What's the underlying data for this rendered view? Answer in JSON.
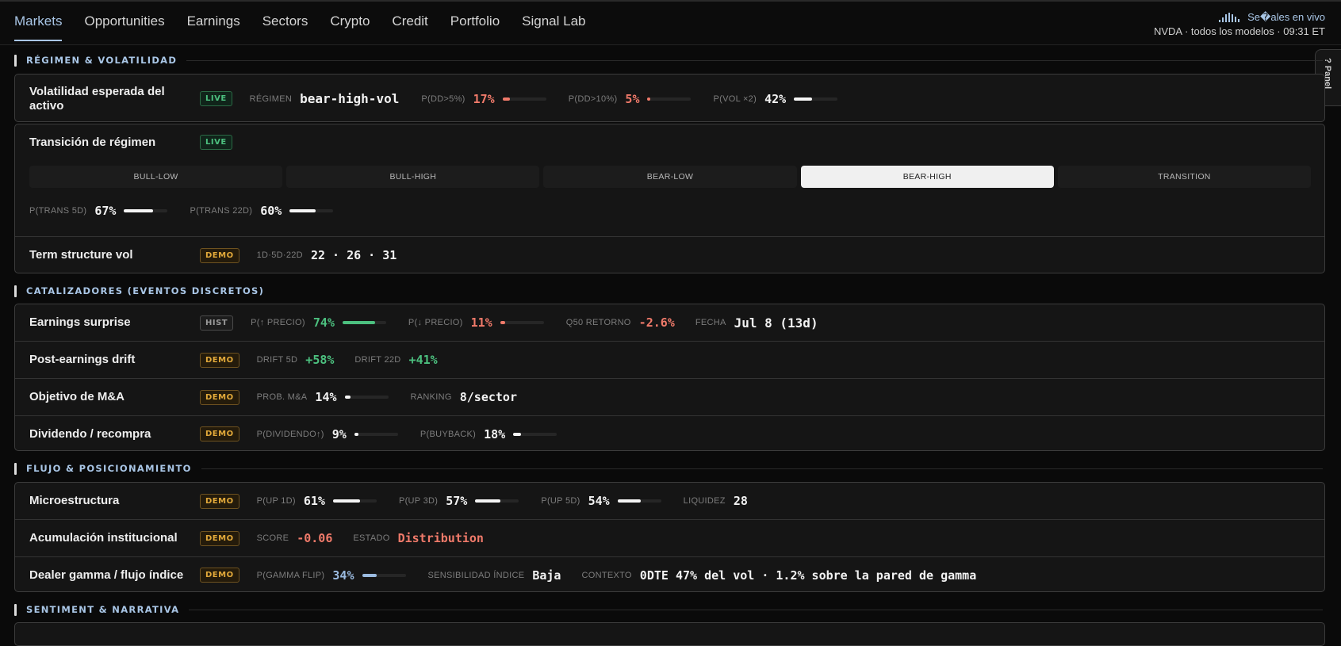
{
  "nav": {
    "tabs": [
      "Markets",
      "Opportunities",
      "Earnings",
      "Sectors",
      "Crypto",
      "Credit",
      "Portfolio",
      "Signal Lab"
    ],
    "active": "Markets",
    "live_label": "Se�ales en vivo",
    "subline": "NVDA · todos los modelos · 09:31 ET"
  },
  "panel_tab": "? Panel",
  "sections": {
    "regime": "RÉGIMEN & VOLATILIDAD",
    "catalysts": "CATALIZADORES (EVENTOS DISCRETOS)",
    "flow": "FLUJO & POSICIONAMIENTO",
    "sentiment": "SENTIMENT & NARRATIVA"
  },
  "volatility": {
    "title": "Volatilidad esperada del activo",
    "badge": "LIVE",
    "regimen_label": "RÉGIMEN",
    "regimen_value": "bear-high-vol",
    "metrics": [
      {
        "label": "P(DD>5%)",
        "value": "17%",
        "fill": 0.17,
        "color": "red"
      },
      {
        "label": "P(DD>10%)",
        "value": "5%",
        "fill": 0.05,
        "color": "red"
      },
      {
        "label": "P(VOL ×2)",
        "value": "42%",
        "fill": 0.42,
        "color": "white"
      }
    ]
  },
  "transition": {
    "title": "Transición de régimen",
    "badge": "LIVE",
    "regimes": [
      "BULL-LOW",
      "BULL-HIGH",
      "BEAR-LOW",
      "BEAR-HIGH",
      "TRANSITION"
    ],
    "active_regime": "BEAR-HIGH",
    "metrics": [
      {
        "label": "P(TRANS 5D)",
        "value": "67%",
        "fill": 0.67
      },
      {
        "label": "P(TRANS 22D)",
        "value": "60%",
        "fill": 0.6
      }
    ]
  },
  "term": {
    "title": "Term structure vol",
    "badge": "DEMO",
    "label": "1D·5D·22D",
    "value": "22 · 26 · 31"
  },
  "earnings": {
    "title": "Earnings surprise",
    "badge": "HIST",
    "p_up_label": "P(↑ PRECIO)",
    "p_up_value": "74%",
    "p_up_fill": 0.74,
    "p_down_label": "P(↓ PRECIO)",
    "p_down_value": "11%",
    "p_down_fill": 0.11,
    "q50_label": "Q50 RETORNO",
    "q50_value": "-2.6%",
    "date_label": "FECHA",
    "date_value": "Jul 8 (13d)"
  },
  "drift": {
    "title": "Post-earnings drift",
    "badge": "DEMO",
    "d5_label": "DRIFT 5D",
    "d5_value": "+58%",
    "d22_label": "DRIFT 22D",
    "d22_value": "+41%"
  },
  "ma": {
    "title": "Objetivo de M&A",
    "badge": "DEMO",
    "prob_label": "PROB. M&A",
    "prob_value": "14%",
    "prob_fill": 0.14,
    "rank_label": "RANKING",
    "rank_value": "8/sector"
  },
  "dividend": {
    "title": "Dividendo / recompra",
    "badge": "DEMO",
    "div_label": "P(DIVIDENDO↑)",
    "div_value": "9%",
    "div_fill": 0.09,
    "bb_label": "P(BUYBACK)",
    "bb_value": "18%",
    "bb_fill": 0.18
  },
  "micro": {
    "title": "Microestructura",
    "badge": "DEMO",
    "metrics": [
      {
        "label": "P(UP 1D)",
        "value": "61%",
        "fill": 0.61
      },
      {
        "label": "P(UP 3D)",
        "value": "57%",
        "fill": 0.57
      },
      {
        "label": "P(UP 5D)",
        "value": "54%",
        "fill": 0.54
      }
    ],
    "liq_label": "LIQUIDEZ",
    "liq_value": "28"
  },
  "institutional": {
    "title": "Acumulación institucional",
    "badge": "DEMO",
    "score_label": "SCORE",
    "score_value": "-0.06",
    "state_label": "ESTADO",
    "state_value": "Distribution"
  },
  "gamma": {
    "title": "Dealer gamma / flujo índice",
    "badge": "DEMO",
    "flip_label": "P(GAMMA FLIP)",
    "flip_value": "34%",
    "flip_fill": 0.34,
    "sens_label": "SENSIBILIDAD ÍNDICE",
    "sens_value": "Baja",
    "ctx_label": "CONTEXTO",
    "ctx_value": "0DTE 47% del vol · 1.2% sobre la pared de gamma"
  }
}
